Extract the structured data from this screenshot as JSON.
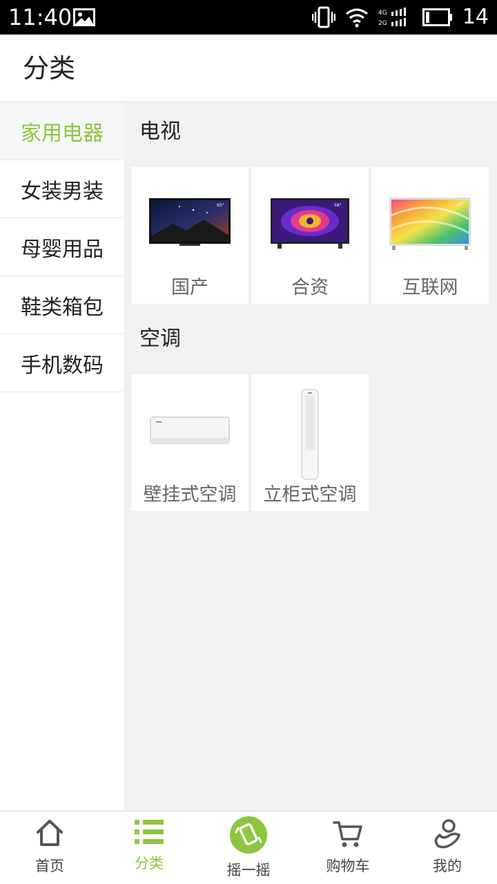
{
  "status_bar": {
    "time": "11:40",
    "battery": "14",
    "net_top": "4G",
    "net_bottom": "2G"
  },
  "header": {
    "title": "分类"
  },
  "sidebar": {
    "items": [
      {
        "label": "家用电器",
        "active": true
      },
      {
        "label": "女装男装"
      },
      {
        "label": "母婴用品"
      },
      {
        "label": "鞋类箱包"
      },
      {
        "label": "手机数码"
      }
    ]
  },
  "sections": [
    {
      "title": "电视",
      "items": [
        {
          "label": "国产"
        },
        {
          "label": "合资"
        },
        {
          "label": "互联网"
        }
      ]
    },
    {
      "title": "空调",
      "items": [
        {
          "label": "壁挂式空调"
        },
        {
          "label": "立柜式空调"
        }
      ]
    }
  ],
  "tv_badges": [
    "65\"",
    "58\"",
    "43\""
  ],
  "tabs": [
    {
      "label": "首页",
      "icon": "home-icon"
    },
    {
      "label": "分类",
      "icon": "list-icon",
      "active": true
    },
    {
      "label": "摇一摇",
      "icon": "shake-phone-icon"
    },
    {
      "label": "购物车",
      "icon": "cart-icon"
    },
    {
      "label": "我的",
      "icon": "user-icon"
    }
  ],
  "colors": {
    "accent": "#8cc63f",
    "background": "#f1f1f1",
    "status_bar": "#000000"
  }
}
